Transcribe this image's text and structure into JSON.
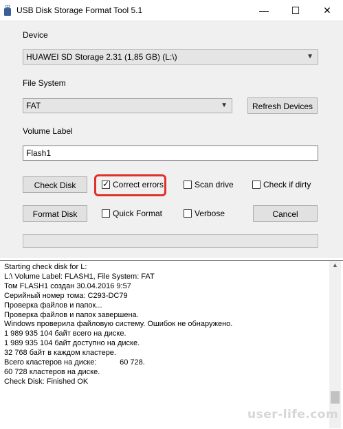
{
  "window": {
    "title": "USB Disk Storage Format Tool 5.1",
    "minimize_glyph": "—",
    "maximize_glyph": "☐",
    "close_glyph": "✕"
  },
  "device": {
    "label": "Device",
    "selected": "HUAWEI  SD Storage  2.31 (1,85 GB) (L:\\)"
  },
  "file_system": {
    "label": "File System",
    "selected": "FAT",
    "refresh_button": "Refresh Devices"
  },
  "volume_label": {
    "label": "Volume Label",
    "value": "Flash1"
  },
  "actions": {
    "check_disk": "Check Disk",
    "format_disk": "Format Disk",
    "cancel": "Cancel"
  },
  "options": {
    "correct_errors": {
      "label": "Correct errors",
      "checked": true
    },
    "scan_drive": {
      "label": "Scan drive",
      "checked": false
    },
    "check_if_dirty": {
      "label": "Check if dirty",
      "checked": false
    },
    "quick_format": {
      "label": "Quick Format",
      "checked": false
    },
    "verbose": {
      "label": "Verbose",
      "checked": false
    }
  },
  "highlight_color": "#e0302a",
  "log": [
    "Starting check disk for L:",
    "L:\\ Volume Label: FLASH1, File System: FAT",
    "Том FLASH1 создан 30.04.2016 9:57",
    "Серийный номер тома: C293-DC79",
    "Проверка файлов и папок...",
    "Проверка файлов и папок завершена.",
    "Windows проверила файловую систему. Ошибок не обнаружено.",
    "1 989 935 104 байт всего на диске.",
    "1 989 935 104 байт доступно на диске.",
    "32 768 байт в каждом кластере.",
    "Всего кластеров на диске:           60 728.",
    "60 728 кластеров на диске.",
    "Check Disk: Finished OK"
  ],
  "watermark": "user-life.com"
}
